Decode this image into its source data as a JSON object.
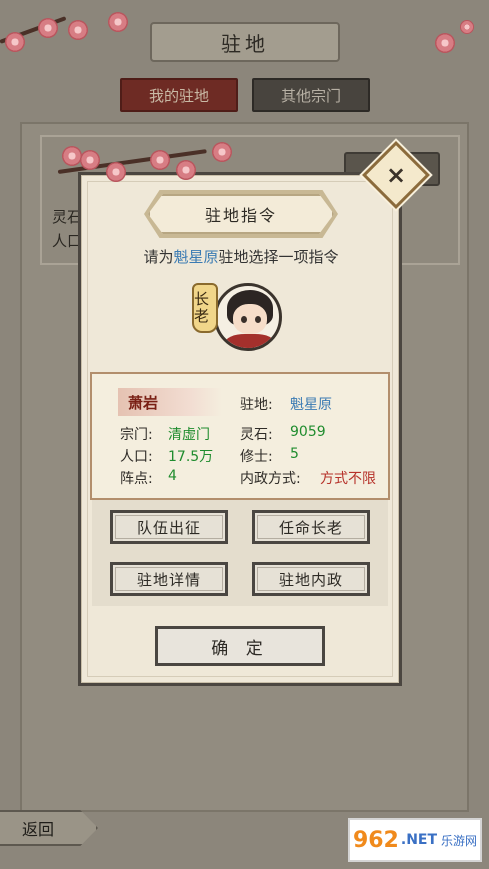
{
  "header": {
    "title": "驻地"
  },
  "tabs": [
    {
      "label": "我的驻地",
      "active": true
    },
    {
      "label": "其他宗门",
      "active": false
    }
  ],
  "background_card": {
    "line1": "灵石",
    "line2": "人口"
  },
  "back_button": {
    "label": "返回"
  },
  "modal": {
    "title": "驻地指令",
    "prompt_prefix": "请为",
    "prompt_highlight": "魁星原",
    "prompt_suffix": "驻地选择一项指令",
    "rank_badge": "长老",
    "info": {
      "name": "萧岩",
      "station_label": "驻地:",
      "station_value": "魁星原",
      "sect_label": "宗门:",
      "sect_value": "清虚门",
      "spirit_stone_label": "灵石:",
      "spirit_stone_value": "9059",
      "population_label": "人口:",
      "population_value": "17.5万",
      "cultivators_label": "修士:",
      "cultivators_value": "5",
      "formation_label": "阵点:",
      "formation_value": "4",
      "governance_label": "内政方式:",
      "governance_value": "方式不限"
    },
    "buttons": {
      "expedition": "队伍出征",
      "appoint_elder": "任命长老",
      "station_details": "驻地详情",
      "station_governance": "驻地内政"
    },
    "confirm": "确 定",
    "close_icon": "×"
  },
  "watermark": {
    "number": "962",
    "net": ".NET",
    "sub": "乐游网"
  },
  "colors": {
    "highlight_blue": "#3b7bb3",
    "value_green": "#1f8c2e",
    "value_red": "#b6322a",
    "name_red": "#7a2015"
  }
}
